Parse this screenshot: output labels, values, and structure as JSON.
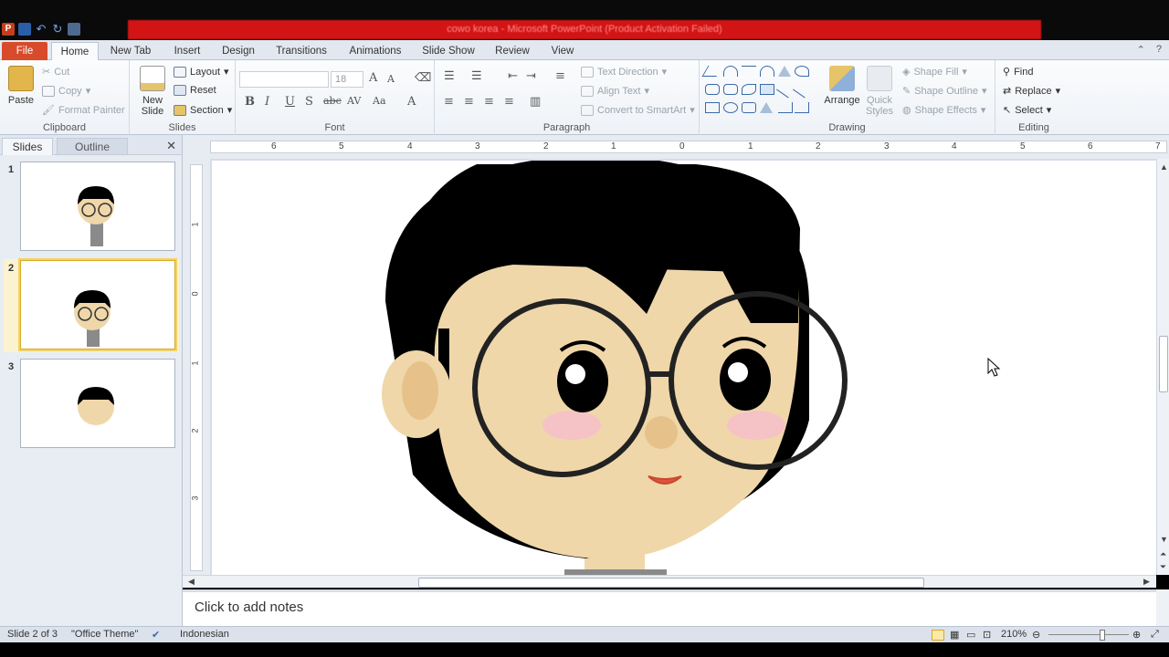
{
  "title_bar": {
    "title": "cowo korea - Microsoft PowerPoint (Product Activation Failed)"
  },
  "tabs": [
    {
      "label": "File"
    },
    {
      "label": "Home"
    },
    {
      "label": "New Tab"
    },
    {
      "label": "Insert"
    },
    {
      "label": "Design"
    },
    {
      "label": "Transitions"
    },
    {
      "label": "Animations"
    },
    {
      "label": "Slide Show"
    },
    {
      "label": "Review"
    },
    {
      "label": "View"
    }
  ],
  "ribbon": {
    "clipboard": {
      "paste": "Paste",
      "cut": "Cut",
      "copy": "Copy",
      "format_painter": "Format Painter",
      "group_label": "Clipboard"
    },
    "slides": {
      "new_slide": "New Slide",
      "layout": "Layout",
      "reset": "Reset",
      "section": "Section",
      "group_label": "Slides"
    },
    "font": {
      "font_size": "18",
      "group_label": "Font"
    },
    "paragraph": {
      "text_direction": "Text Direction",
      "align_text": "Align Text",
      "convert_smartart": "Convert to SmartArt",
      "group_label": "Paragraph"
    },
    "drawing": {
      "arrange": "Arrange",
      "quick_styles": "Quick Styles",
      "shape_fill": "Shape Fill",
      "shape_outline": "Shape Outline",
      "shape_effects": "Shape Effects",
      "group_label": "Drawing"
    },
    "editing": {
      "find": "Find",
      "replace": "Replace",
      "select": "Select",
      "group_label": "Editing"
    }
  },
  "left_pane": {
    "tab_slides": "Slides",
    "tab_outline": "Outline",
    "thumbnails": [
      {
        "number": "1"
      },
      {
        "number": "2"
      },
      {
        "number": "3"
      }
    ]
  },
  "rulers": {
    "horizontal": [
      "6",
      "5",
      "4",
      "3",
      "2",
      "1",
      "0",
      "1",
      "2",
      "3",
      "4",
      "5",
      "6",
      "7"
    ],
    "vertical": [
      "1",
      "0",
      "1",
      "2",
      "3"
    ]
  },
  "notes": {
    "placeholder": "Click to add notes"
  },
  "status_bar": {
    "slide_info": "Slide 2 of 3",
    "theme": "\"Office Theme\"",
    "language": "Indonesian",
    "zoom": "210%"
  },
  "colors": {
    "file_tab": "#d84b2a",
    "title_bar_red": "#d21414",
    "skin": "#efd7aa",
    "hair": "#000000",
    "blush": "#f5c3c6",
    "selection": "#f3d264"
  }
}
